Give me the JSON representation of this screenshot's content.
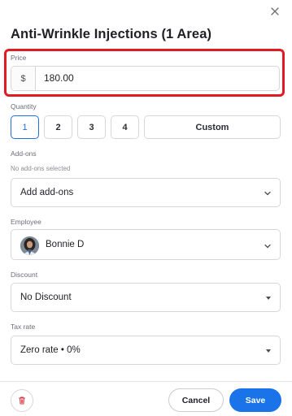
{
  "dialog": {
    "title": "Anti-Wrinkle Injections (1 Area)",
    "close_icon": "close-icon"
  },
  "price": {
    "label": "Price",
    "currency_symbol": "$",
    "value": "180.00"
  },
  "quantity": {
    "label": "Quantity",
    "options": [
      "1",
      "2",
      "3",
      "4"
    ],
    "selected": "1",
    "custom_label": "Custom"
  },
  "addons": {
    "label": "Add-ons",
    "status": "No add-ons selected",
    "button_label": "Add add-ons"
  },
  "employee": {
    "label": "Employee",
    "selected": "Bonnie D"
  },
  "discount": {
    "label": "Discount",
    "selected": "No Discount"
  },
  "tax": {
    "label": "Tax rate",
    "selected": "Zero rate • 0%"
  },
  "footer": {
    "delete_icon": "trash-icon",
    "cancel_label": "Cancel",
    "save_label": "Save"
  },
  "colors": {
    "accent": "#1a73e8",
    "highlight": "#e01b24",
    "delete": "#d9363e"
  }
}
